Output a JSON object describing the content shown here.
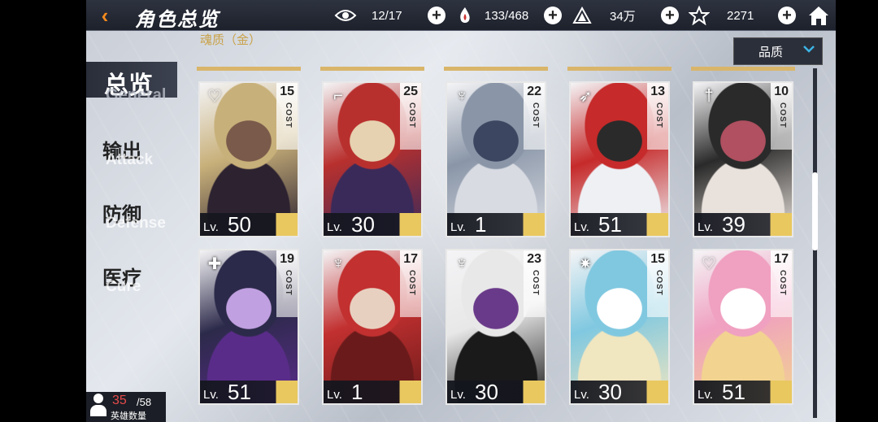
{
  "header": {
    "back_icon": "back-arrow-icon",
    "title": "角色总览",
    "subtitle": "魂质（金）",
    "resources": [
      {
        "icon": "eye-icon",
        "value": "12/17"
      },
      {
        "icon": "fire-hand-icon",
        "value": "133/468"
      },
      {
        "icon": "triangle-crystal-icon",
        "value": "34万"
      },
      {
        "icon": "star-shard-icon",
        "value": "2271"
      }
    ],
    "home_icon": "home-icon"
  },
  "quality_filter": {
    "label": "品质",
    "icon": "chevron-down-icon"
  },
  "categories": [
    {
      "cn": "总览",
      "en": "General",
      "active": true
    },
    {
      "cn": "输出",
      "en": "Attack",
      "active": false
    },
    {
      "cn": "防御",
      "en": "Defense",
      "active": false
    },
    {
      "cn": "医疗",
      "en": "Cure",
      "active": false
    }
  ],
  "cards": [
    {
      "cost": "15",
      "cost_label": "COST",
      "class_icon": "heart-wing-icon",
      "lv_prefix": "Lv.",
      "level": "50",
      "palette": [
        "#2c2230",
        "#c8b07a",
        "#7a5a4a"
      ]
    },
    {
      "cost": "25",
      "cost_label": "COST",
      "class_icon": "pistol-icon",
      "lv_prefix": "Lv.",
      "level": "30",
      "palette": [
        "#3a2a5a",
        "#b8302e",
        "#e6d2b0"
      ]
    },
    {
      "cost": "22",
      "cost_label": "COST",
      "class_icon": "horned-shield-icon",
      "lv_prefix": "Lv.",
      "level": "1",
      "palette": [
        "#d8dbe2",
        "#8a96a8",
        "#3c4660"
      ]
    },
    {
      "cost": "13",
      "cost_label": "COST",
      "class_icon": "bow-icon",
      "lv_prefix": "Lv.",
      "level": "51",
      "palette": [
        "#eef0f4",
        "#c62a2a",
        "#2a2a2a"
      ]
    },
    {
      "cost": "10",
      "cost_label": "COST",
      "class_icon": "sword-icon",
      "lv_prefix": "Lv.",
      "level": "39",
      "palette": [
        "#e9e2dc",
        "#2a2a2a",
        "#b05060"
      ]
    },
    {
      "cost": "19",
      "cost_label": "COST",
      "class_icon": "cross-shield-icon",
      "lv_prefix": "Lv.",
      "level": "51",
      "palette": [
        "#5a2c8a",
        "#2c2a4a",
        "#c0a0e0"
      ]
    },
    {
      "cost": "17",
      "cost_label": "COST",
      "class_icon": "trident-wing-icon",
      "lv_prefix": "Lv.",
      "level": "1",
      "palette": [
        "#6a1a1a",
        "#c23030",
        "#e8d0c0"
      ]
    },
    {
      "cost": "23",
      "cost_label": "COST",
      "class_icon": "horned-shield-icon",
      "lv_prefix": "Lv.",
      "level": "30",
      "palette": [
        "#1a1a1a",
        "#e8e8e8",
        "#6a3a8a"
      ]
    },
    {
      "cost": "15",
      "cost_label": "COST",
      "class_icon": "flower-star-icon",
      "lv_prefix": "Lv.",
      "level": "30",
      "palette": [
        "#f0e6c0",
        "#80c8e0",
        "#ffffff"
      ]
    },
    {
      "cost": "17",
      "cost_label": "COST",
      "class_icon": "heart-wing-icon",
      "lv_prefix": "Lv.",
      "level": "51",
      "palette": [
        "#f2d490",
        "#f0a0c0",
        "#ffffff"
      ]
    }
  ],
  "hero_count": {
    "current": "35",
    "max": "/58",
    "label": "英雄数量"
  },
  "scroll_position": 0.28
}
